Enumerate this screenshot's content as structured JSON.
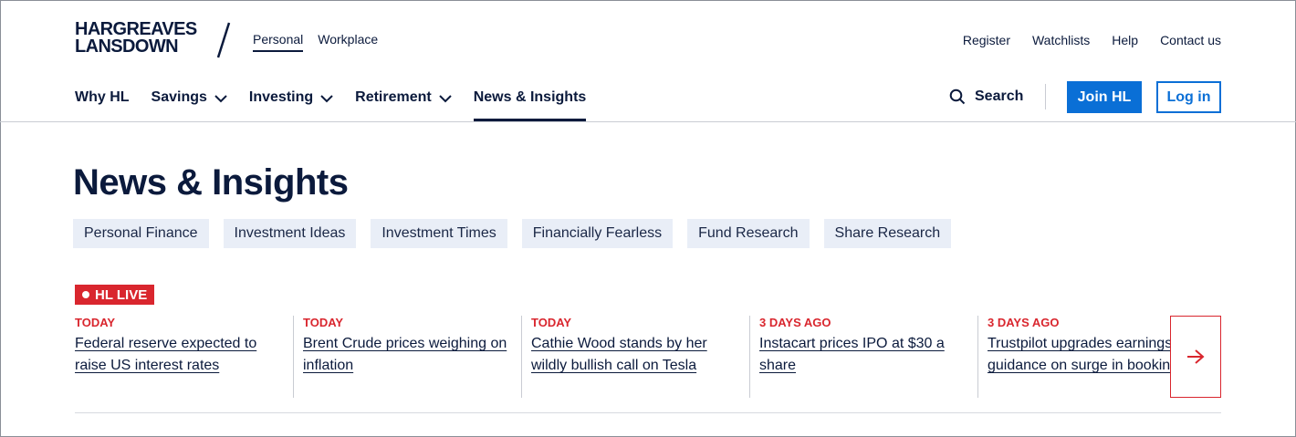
{
  "brand": {
    "line1": "HARGREAVES",
    "line2": "LANSDOWN"
  },
  "top_tabs": [
    {
      "label": "Personal"
    },
    {
      "label": "Workplace"
    }
  ],
  "utility_links": [
    {
      "label": "Register"
    },
    {
      "label": "Watchlists"
    },
    {
      "label": "Help"
    },
    {
      "label": "Contact us"
    }
  ],
  "main_nav": [
    {
      "label": "Why HL"
    },
    {
      "label": "Savings"
    },
    {
      "label": "Investing"
    },
    {
      "label": "Retirement"
    },
    {
      "label": "News & Insights"
    }
  ],
  "search": {
    "label": "Search",
    "icon": "search-icon"
  },
  "buttons": {
    "join": "Join HL",
    "login": "Log in"
  },
  "page": {
    "title": "News & Insights",
    "categories": [
      "Personal Finance",
      "Investment Ideas",
      "Investment Times",
      "Financially Fearless",
      "Fund Research",
      "Share Research"
    ]
  },
  "live": {
    "badge": "HL LIVE",
    "items": [
      {
        "time": "TODAY",
        "headline": "Federal reserve expected to raise US interest rates"
      },
      {
        "time": "TODAY",
        "headline": "Brent Crude prices weighing on inflation"
      },
      {
        "time": "TODAY",
        "headline": "Cathie Wood stands by her wildly bullish call on Tesla"
      },
      {
        "time": "3 DAYS AGO",
        "headline": "Instacart prices IPO at $30 a share"
      },
      {
        "time": "3 DAYS AGO",
        "headline": "Trustpilot upgrades earnings guidance on surge in bookings"
      }
    ]
  },
  "colors": {
    "navy": "#0b1a3c",
    "blue": "#0a6fd6",
    "red": "#d9262e",
    "chip": "#e9eef7"
  }
}
